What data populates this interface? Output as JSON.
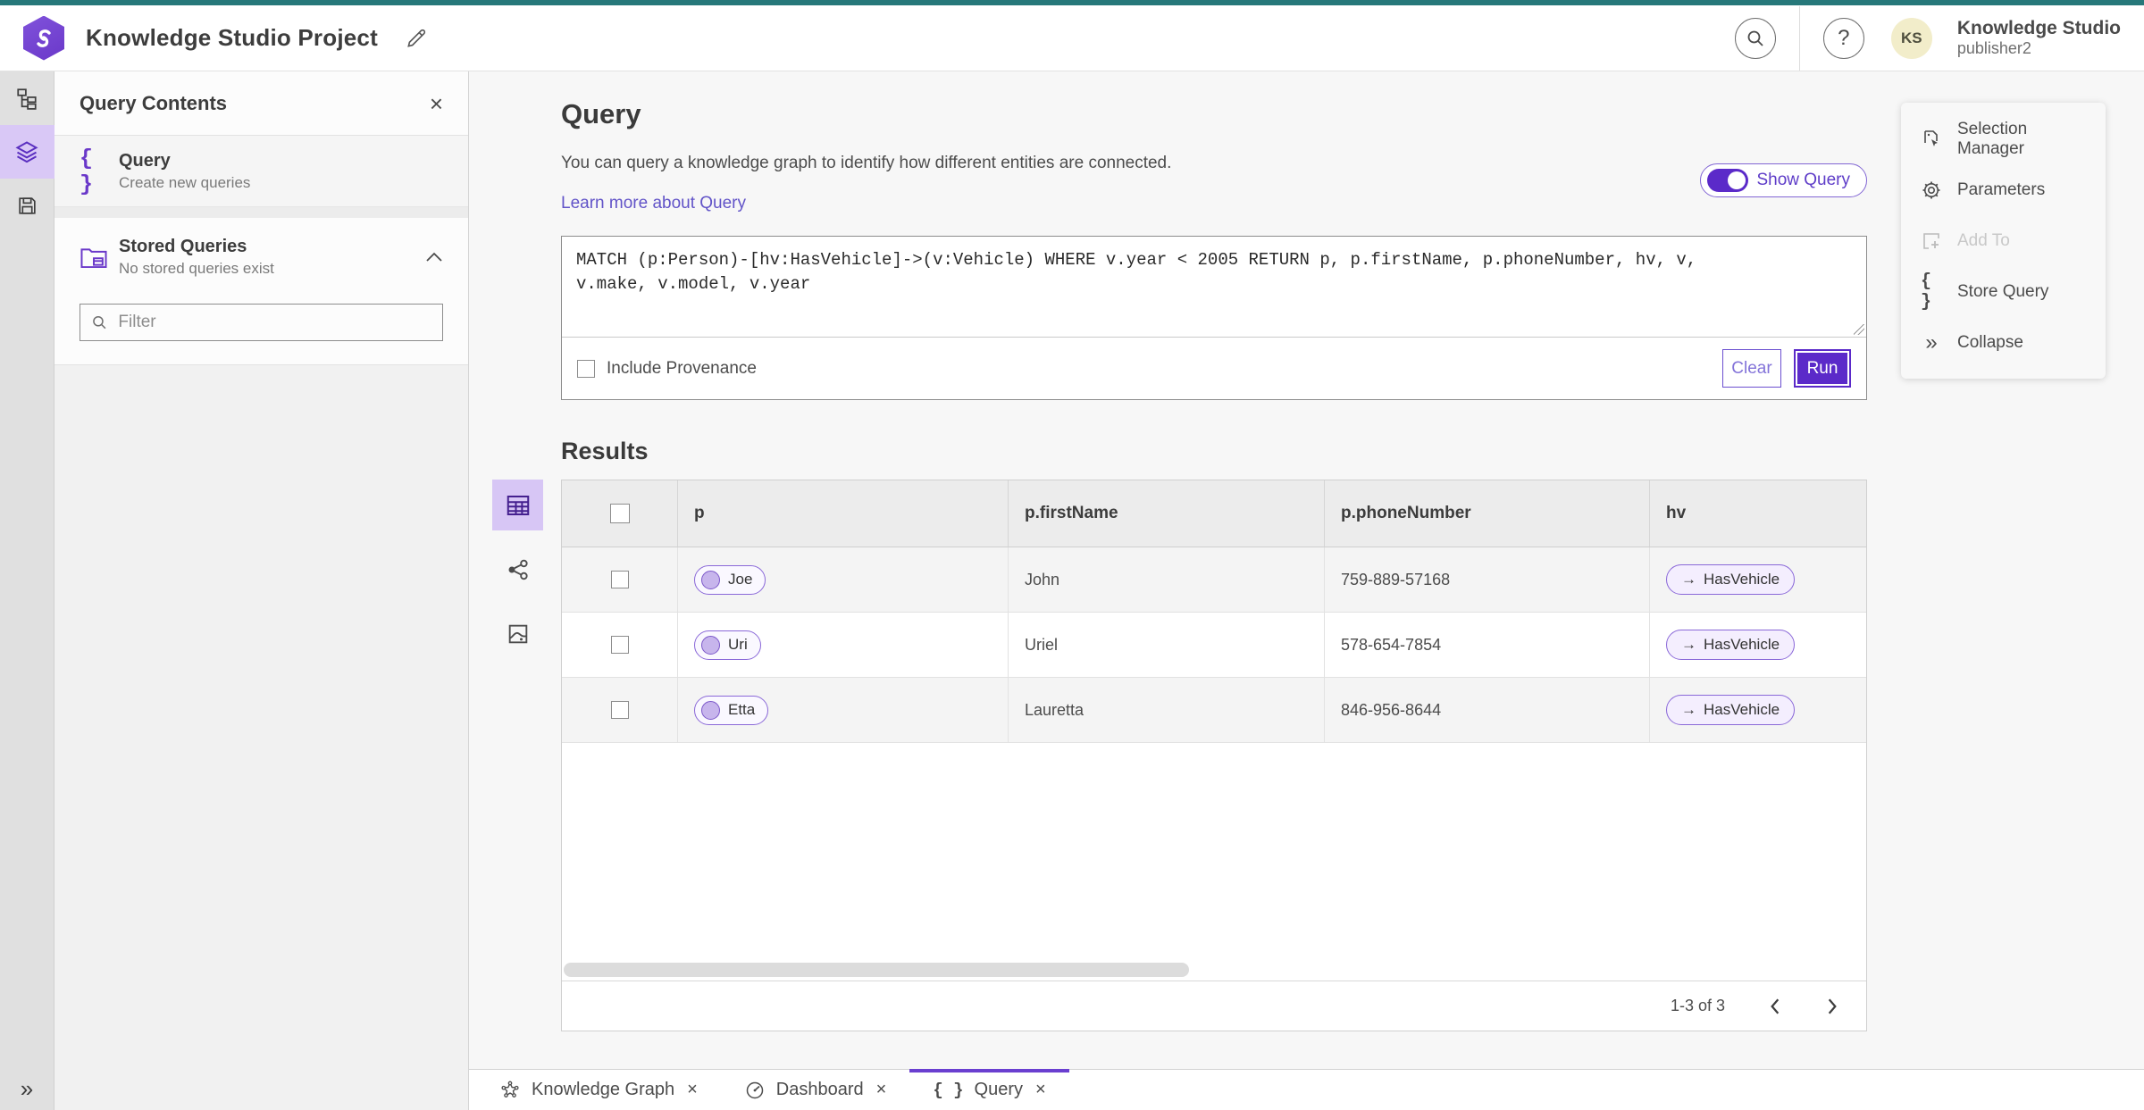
{
  "colors": {
    "accent": "#5b2ac9",
    "accent_soft": "#d9c8f6",
    "teal_strip": "#26787a",
    "link": "#6254c8"
  },
  "icons": {
    "close": "×",
    "help": "?",
    "braces": "{ }",
    "collapse": "»",
    "expand": "»",
    "edge_arrow": "→"
  },
  "topbar": {
    "title": "Knowledge Studio Project",
    "product": "Knowledge Studio",
    "user": "publisher2",
    "avatar_initials": "KS"
  },
  "sidebar": {
    "panel_title": "Query Contents",
    "query_item": {
      "title": "Query",
      "subtitle": "Create new queries"
    },
    "stored": {
      "title": "Stored Queries",
      "subtitle": "No stored queries exist"
    },
    "filter_placeholder": "Filter"
  },
  "query": {
    "heading": "Query",
    "description": "You can query a knowledge graph to identify how different entities are connected.",
    "learn_more": "Learn more about Query",
    "show_query_label": "Show Query",
    "code": "MATCH (p:Person)-[hv:HasVehicle]->(v:Vehicle) WHERE v.year < 2005 RETURN p, p.firstName, p.phoneNumber, hv, v,\nv.make, v.model, v.year",
    "include_provenance_label": "Include Provenance",
    "clear_label": "Clear",
    "run_label": "Run"
  },
  "results": {
    "heading": "Results",
    "columns": [
      "p",
      "p.firstName",
      "p.phoneNumber",
      "hv"
    ],
    "rows": [
      {
        "p": "Joe",
        "firstName": "John",
        "phoneNumber": "759-889-57168",
        "hv": "HasVehicle"
      },
      {
        "p": "Uri",
        "firstName": "Uriel",
        "phoneNumber": "578-654-7854",
        "hv": "HasVehicle"
      },
      {
        "p": "Etta",
        "firstName": "Lauretta",
        "phoneNumber": "846-956-8644",
        "hv": "HasVehicle"
      }
    ],
    "pagination": "1-3 of 3"
  },
  "right_panel": {
    "items": [
      {
        "label": "Selection Manager"
      },
      {
        "label": "Parameters"
      },
      {
        "label": "Add To"
      },
      {
        "label": "Store Query"
      },
      {
        "label": "Collapse"
      }
    ]
  },
  "tabs": [
    {
      "label": "Knowledge Graph"
    },
    {
      "label": "Dashboard"
    },
    {
      "label": "Query"
    }
  ]
}
